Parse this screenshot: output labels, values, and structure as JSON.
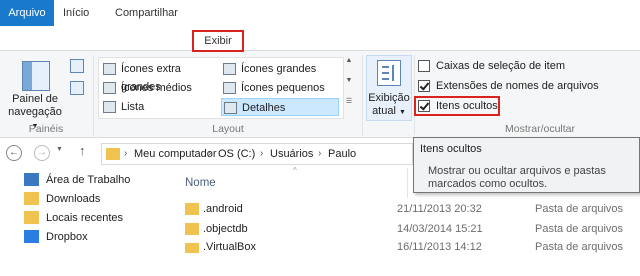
{
  "tabs": {
    "arquivo": "Arquivo",
    "inicio": "Início",
    "compartilhar": "Compartilhar",
    "exibir": "Exibir"
  },
  "ribbon": {
    "paineis": {
      "button_line1": "Painel de",
      "button_line2": "navegação",
      "group_label": "Painéis"
    },
    "layout": {
      "items": [
        "Ícones extra grandes",
        "Ícones grandes",
        "Ícones médios",
        "Ícones pequenos",
        "Lista",
        "Detalhes"
      ],
      "selected": "Detalhes",
      "group_label": "Layout"
    },
    "exibicao": {
      "line1": "Exibição",
      "line2": "atual"
    },
    "mostrar": {
      "checkboxes": [
        {
          "label": "Caixas de seleção de item",
          "checked": false
        },
        {
          "label": "Extensões de nomes de arquivos",
          "checked": true
        },
        {
          "label": "Itens ocultos",
          "checked": true
        }
      ],
      "group_label": "Mostrar/ocultar"
    }
  },
  "address": {
    "crumbs": [
      "Meu computador",
      "OS (C:)",
      "Usuários",
      "Paulo"
    ]
  },
  "tooltip": {
    "title": "Itens ocultos",
    "line1": "Mostrar ou ocultar arquivos e pastas",
    "line2": "marcados como ocultos."
  },
  "nav_pane": {
    "items": [
      "Área de Trabalho",
      "Downloads",
      "Locais recentes",
      "Dropbox"
    ]
  },
  "file_list": {
    "column_name": "Nome",
    "rows": [
      {
        "name": ".android",
        "date": "21/11/2013 20:32",
        "type": "Pasta de arquivos"
      },
      {
        "name": ".objectdb",
        "date": "14/03/2014 15:21",
        "type": "Pasta de arquivos"
      },
      {
        "name": ".VirtualBox",
        "date": "16/11/2013 14:12",
        "type": "Pasta de arquivos"
      }
    ]
  },
  "colors": {
    "accent": "#1979ca",
    "highlight": "#d9231f",
    "selected_bg": "#cce8ff"
  }
}
